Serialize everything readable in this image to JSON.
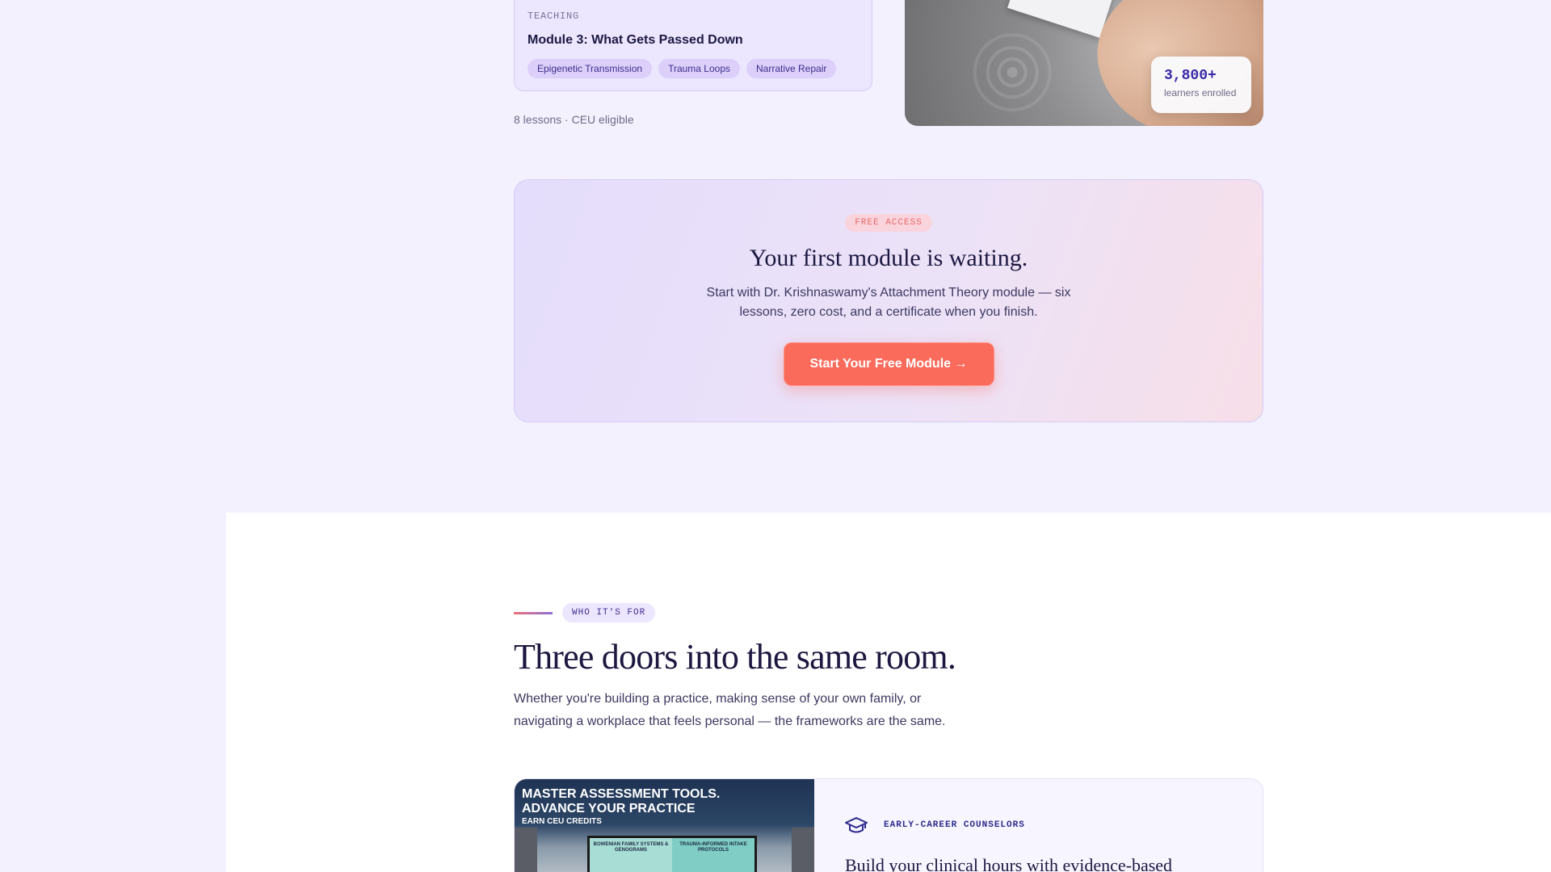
{
  "module": {
    "eyebrow": "TEACHING",
    "title": "Module 3: What Gets Passed Down",
    "tags": [
      "Epigenetic Transmission",
      "Trauma Loops",
      "Narrative Repair"
    ],
    "meta": "8 lessons · CEU eligible"
  },
  "enrollment": {
    "count": "3,800+",
    "label": "learners enrolled"
  },
  "cta": {
    "pill": "FREE ACCESS",
    "title": "Your first module is waiting.",
    "body": "Start with Dr. Krishnaswamy's Attachment Theory module — six lessons, zero cost, and a certificate when you finish.",
    "button_label": "Start Your Free Module →"
  },
  "audience": {
    "eyebrow": "WHO IT'S FOR",
    "title": "Three doors into the same room.",
    "subtitle": "Whether you're building a practice, making sense of your own family, or navigating a workplace that feels personal — the frameworks are the same.",
    "cards": [
      {
        "image": {
          "headline_line1": "MASTER ASSESSMENT TOOLS.",
          "headline_line2": "ADVANCE YOUR PRACTICE",
          "subline": "EARN CEU CREDITS",
          "board_left": "BOWENIAN FAMILY SYSTEMS & GENOGRAMS",
          "board_right": "TRAUMA-INFORMED INTAKE PROTOCOLS"
        },
        "icon": "graduation-cap-icon",
        "eyebrow": "EARLY-CAREER COUNSELORS",
        "heading": "Build your clinical hours with evidence-based"
      }
    ]
  },
  "colors": {
    "page_bg": "#f4f1ff",
    "accent_coral": "#fa6b5c",
    "accent_purple": "#3a2aa8",
    "ink": "#1c1840"
  }
}
